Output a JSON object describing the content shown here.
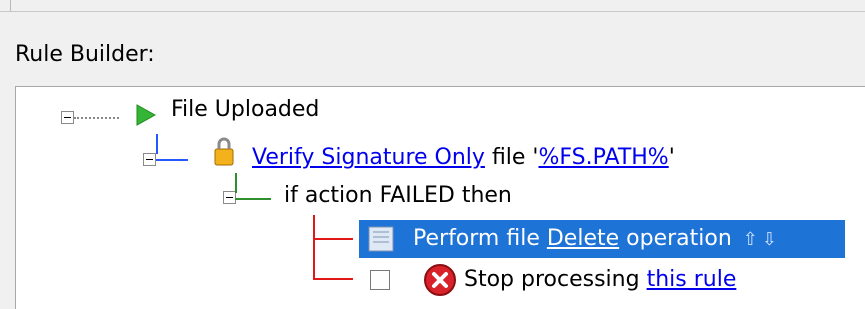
{
  "panel": {
    "title": "Rule Builder:"
  },
  "tree": {
    "root": {
      "label": "File Uploaded"
    },
    "verify": {
      "action": "Verify Signature Only",
      "text": "file '",
      "path": "%FS.PATH%",
      "close": "'"
    },
    "condition": {
      "label": "if action FAILED then"
    },
    "perform": {
      "prefix": "Perform file ",
      "operation": "Delete",
      "suffix": " operation",
      "up_icon": "up-arrow-icon",
      "down_icon": "down-arrow-icon"
    },
    "stop": {
      "prefix": "Stop processing ",
      "target": "this rule"
    }
  },
  "colors": {
    "selection": "#1e73d7",
    "line_blue": "#2459ff",
    "line_green": "#2f8f2f",
    "line_red": "#e21818"
  }
}
